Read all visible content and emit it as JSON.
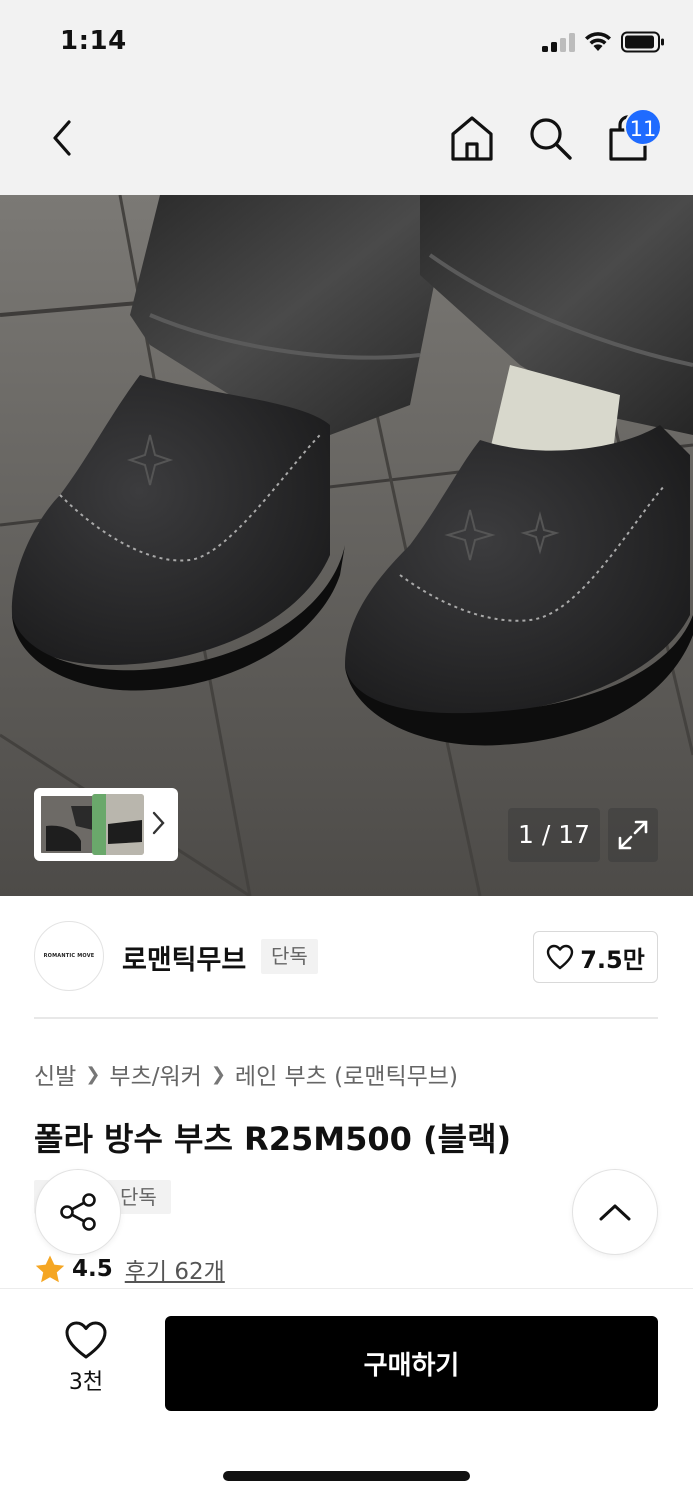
{
  "status": {
    "time": "1:14"
  },
  "nav": {
    "cart_count": "11",
    "icons": [
      "back-arrow-icon",
      "home-icon",
      "search-icon",
      "cart-icon"
    ]
  },
  "hero": {
    "counter": "1 / 17",
    "icons": [
      "chevron-right-icon",
      "expand-icon"
    ]
  },
  "brand": {
    "logo_text": "ROMANTIC MOVE",
    "name": "로맨틱무브",
    "tag": "단독",
    "likes": "7.5만"
  },
  "product": {
    "breadcrumb": [
      "신발",
      "부츠/워커",
      "레인 부츠 (로맨틱무브)"
    ],
    "title": "폴라 방수 부츠 R25M500 (블랙)",
    "tag": "단독",
    "rating": "4.5",
    "reviews": "후기 62개"
  },
  "bottom": {
    "wish_count": "3천",
    "buy_label": "구매하기"
  },
  "colors": {
    "accent": "#1f6bff",
    "star": "#f5a623",
    "buy_button": "#000000"
  }
}
